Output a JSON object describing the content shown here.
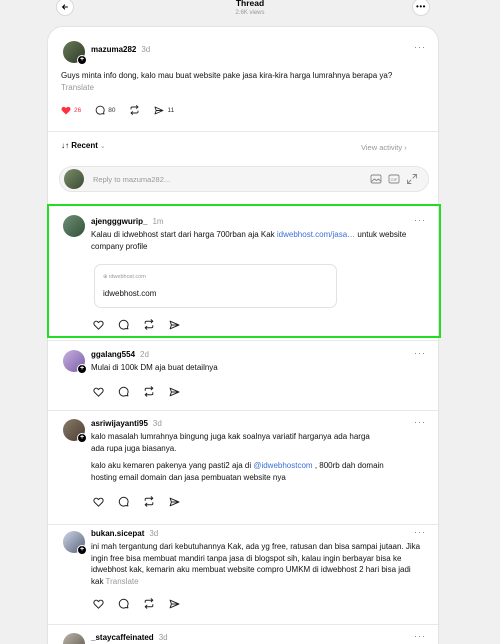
{
  "header": {
    "title": "Thread",
    "views": "2.6K views"
  },
  "main_post": {
    "username": "mazuma282",
    "time": "3d",
    "text": "Guys minta info dong, kalo mau buat website pake jasa kira-kira harga lumrahnya berapa ya?",
    "translate": "Translate",
    "likes": "26",
    "replies": "80",
    "shares": "11"
  },
  "sort": {
    "label": "Recent",
    "view_activity": "View activity"
  },
  "reply_box": {
    "placeholder": "Reply to mazuma282..."
  },
  "replies": [
    {
      "username": "ajengggwurip_",
      "time": "1m",
      "text_before": "Kalau di idwebhost start dari harga 700rban aja Kak ",
      "link": "idwebhost.com/jasa…",
      "text_after": " untuk website company profile",
      "link_card": {
        "domain": "idwebhost.com",
        "title": "idwebhost.com"
      }
    },
    {
      "username": "ggalang554",
      "time": "2d",
      "text": "Mulai di 100k DM aja buat detailnya"
    },
    {
      "username": "asriwijayanti95",
      "time": "3d",
      "text": "kalo masalah lumrahnya bingung juga kak soalnya variatif harganya ada harga ada rupa juga biasanya.",
      "text2_before": "kalo aku kemaren pakenya yang pasti2 aja di ",
      "mention": "@idwebhostcom",
      "text2_after": " , 800rb dah domain hosting email domain dan jasa pembuatan website nya"
    },
    {
      "username": "bukan.sicepat",
      "time": "3d",
      "text": "ini mah tergantung dari kebutuhannya Kak, ada yg free, ratusan dan bisa sampai jutaan. Jika ingin free bisa membuat mandiri tanpa jasa di blogspot sih, kalau ingin berbayar bisa ke idwebhost kak, kemarin aku membuat website compro UMKM di idwebhost 2 hari bisa jadi kak",
      "translate": "Translate"
    },
    {
      "username": "_staycaffeinated",
      "time": "3d"
    }
  ],
  "icons": {
    "back": "arrow-left-icon",
    "more": "more-horizontal-icon",
    "like": "heart-icon",
    "reply": "comment-icon",
    "repost": "repost-icon",
    "share": "send-icon"
  },
  "colors": {
    "highlight": "#22dd22",
    "link": "#3b6fd6",
    "like": "#ff3040"
  }
}
